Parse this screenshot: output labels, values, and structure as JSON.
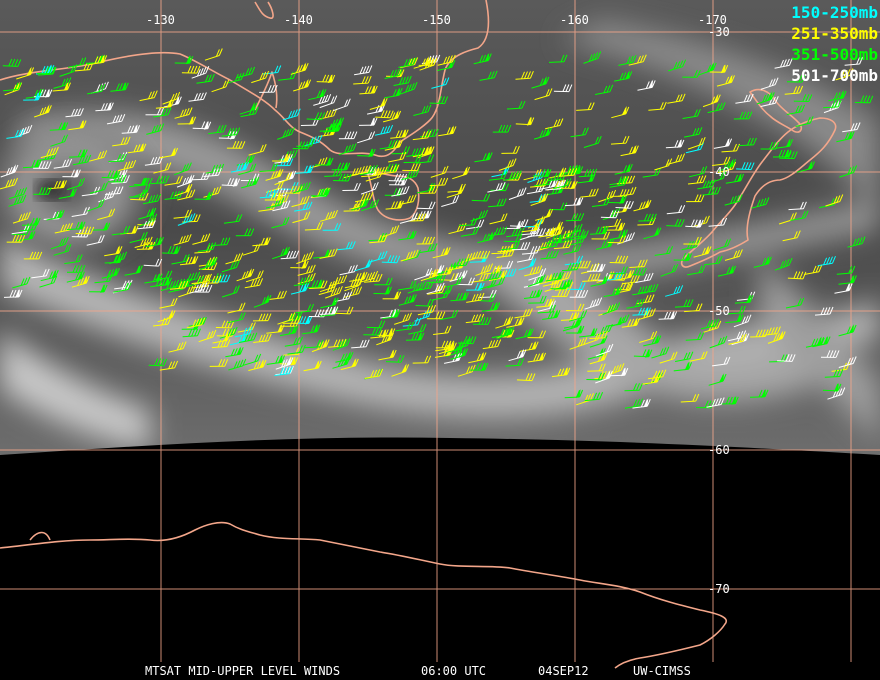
{
  "map": {
    "lon_labels": [
      "-130",
      "-140",
      "-150",
      "-160",
      "-170"
    ],
    "lat_labels": [
      "-30",
      "-40",
      "-50",
      "-60",
      "-70"
    ],
    "colors": {
      "gridline": "#f3a68a",
      "coastline": "#f3a68a",
      "cloud_light": "#bdbdbd",
      "cloud_dark": "#3d3d3d",
      "space": "#000000"
    }
  },
  "legend": [
    {
      "label": "150-250mb",
      "color": "#00ffff"
    },
    {
      "label": "251-350mb",
      "color": "#ffff00"
    },
    {
      "label": "351-500mb",
      "color": "#00ff00"
    },
    {
      "label": "501-700mb",
      "color": "#ffffff"
    }
  ],
  "footer": {
    "title": "MTSAT MID-UPPER LEVEL WINDS",
    "time": "06:00 UTC",
    "date": "04SEP12",
    "source": "UW-CIMSS"
  }
}
